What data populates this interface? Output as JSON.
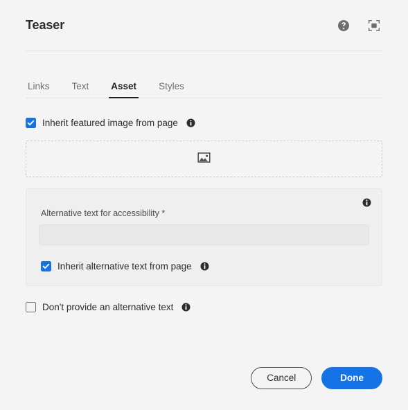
{
  "header": {
    "title": "Teaser",
    "help_icon": "help-circle-icon",
    "fullscreen_icon": "fullscreen-icon"
  },
  "tabs": [
    {
      "label": "Links",
      "active": false
    },
    {
      "label": "Text",
      "active": false
    },
    {
      "label": "Asset",
      "active": true
    },
    {
      "label": "Styles",
      "active": false
    }
  ],
  "asset_tab": {
    "inherit_featured_image": {
      "label": "Inherit featured image from page",
      "checked": true,
      "info_icon": "info-icon"
    },
    "dropzone": {
      "icon": "image-icon"
    },
    "alt_panel": {
      "info_icon": "info-icon",
      "field_label": "Alternative text for accessibility *",
      "input_value": "",
      "input_placeholder": "",
      "inherit_alt_text": {
        "label": "Inherit alternative text from page",
        "checked": true,
        "info_icon": "info-icon"
      }
    },
    "no_alt_text": {
      "label": "Don't provide an alternative text",
      "checked": false,
      "info_icon": "info-icon"
    }
  },
  "footer": {
    "cancel_label": "Cancel",
    "done_label": "Done"
  },
  "colors": {
    "accent": "#1473e6",
    "page_bg": "#f4f4f4",
    "panel_bg": "#efefef",
    "input_bg": "#e8e8e8",
    "text": "#2c2c2c",
    "muted_text": "#6e6e6e",
    "divider": "#e1e1e1",
    "dashed_border": "#c8c8c8",
    "icon_gray": "#6e6e6e"
  }
}
